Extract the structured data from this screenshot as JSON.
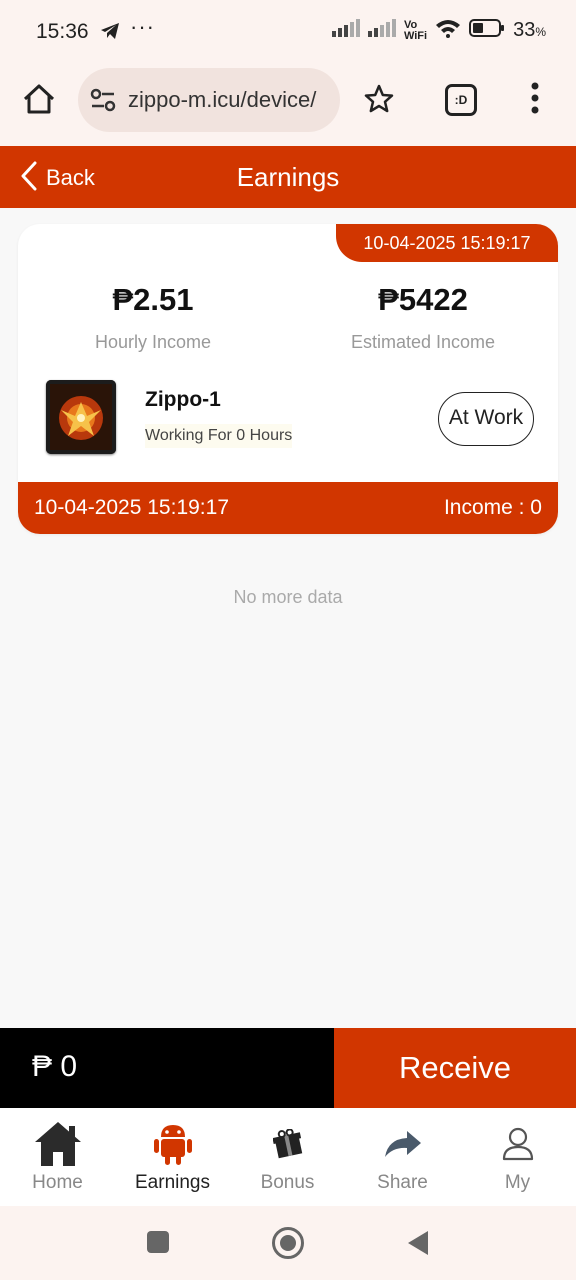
{
  "status_bar": {
    "time": "15:36",
    "more": "···",
    "battery_value": "33",
    "battery_unit": "%",
    "network_label_top": "Vo",
    "network_label_bottom": "WiFi",
    "icons": [
      "telegram-icon",
      "signal-icon",
      "signal-icon",
      "vowifi-icon",
      "wifi-icon",
      "battery-icon"
    ]
  },
  "browser": {
    "url": "zippo-m.icu/device/",
    "tabs_label": ":D",
    "icons": [
      "home-icon",
      "site-settings-icon",
      "star-icon",
      "tabs-icon",
      "menu-icon"
    ]
  },
  "header": {
    "back_label": "Back",
    "title": "Earnings"
  },
  "card": {
    "date_tag": "10-04-2025 15:19:17",
    "hourly_value": "₱2.51",
    "hourly_label": "Hourly Income",
    "estimated_value": "₱5422",
    "estimated_label": "Estimated Income",
    "device_name": "Zippo-1",
    "working_text": "Working For 0 Hours",
    "status_label": "At Work",
    "footer_date": "10-04-2025 15:19:17",
    "footer_income": "Income : 0"
  },
  "list_end_text": "No more data",
  "receive_bar": {
    "balance": "₱ 0",
    "receive_label": "Receive"
  },
  "bottom_nav": {
    "items": [
      {
        "label": "Home",
        "icon": "home-icon",
        "active": false
      },
      {
        "label": "Earnings",
        "icon": "android-icon",
        "active": true
      },
      {
        "label": "Bonus",
        "icon": "gift-icon",
        "active": false
      },
      {
        "label": "Share",
        "icon": "share-icon",
        "active": false
      },
      {
        "label": "My",
        "icon": "user-icon",
        "active": false
      }
    ]
  },
  "colors": {
    "accent": "#d13600",
    "balance_bg": "#000000",
    "page_bg": "#f8f8f8",
    "browser_bg": "#fcf3f0"
  }
}
